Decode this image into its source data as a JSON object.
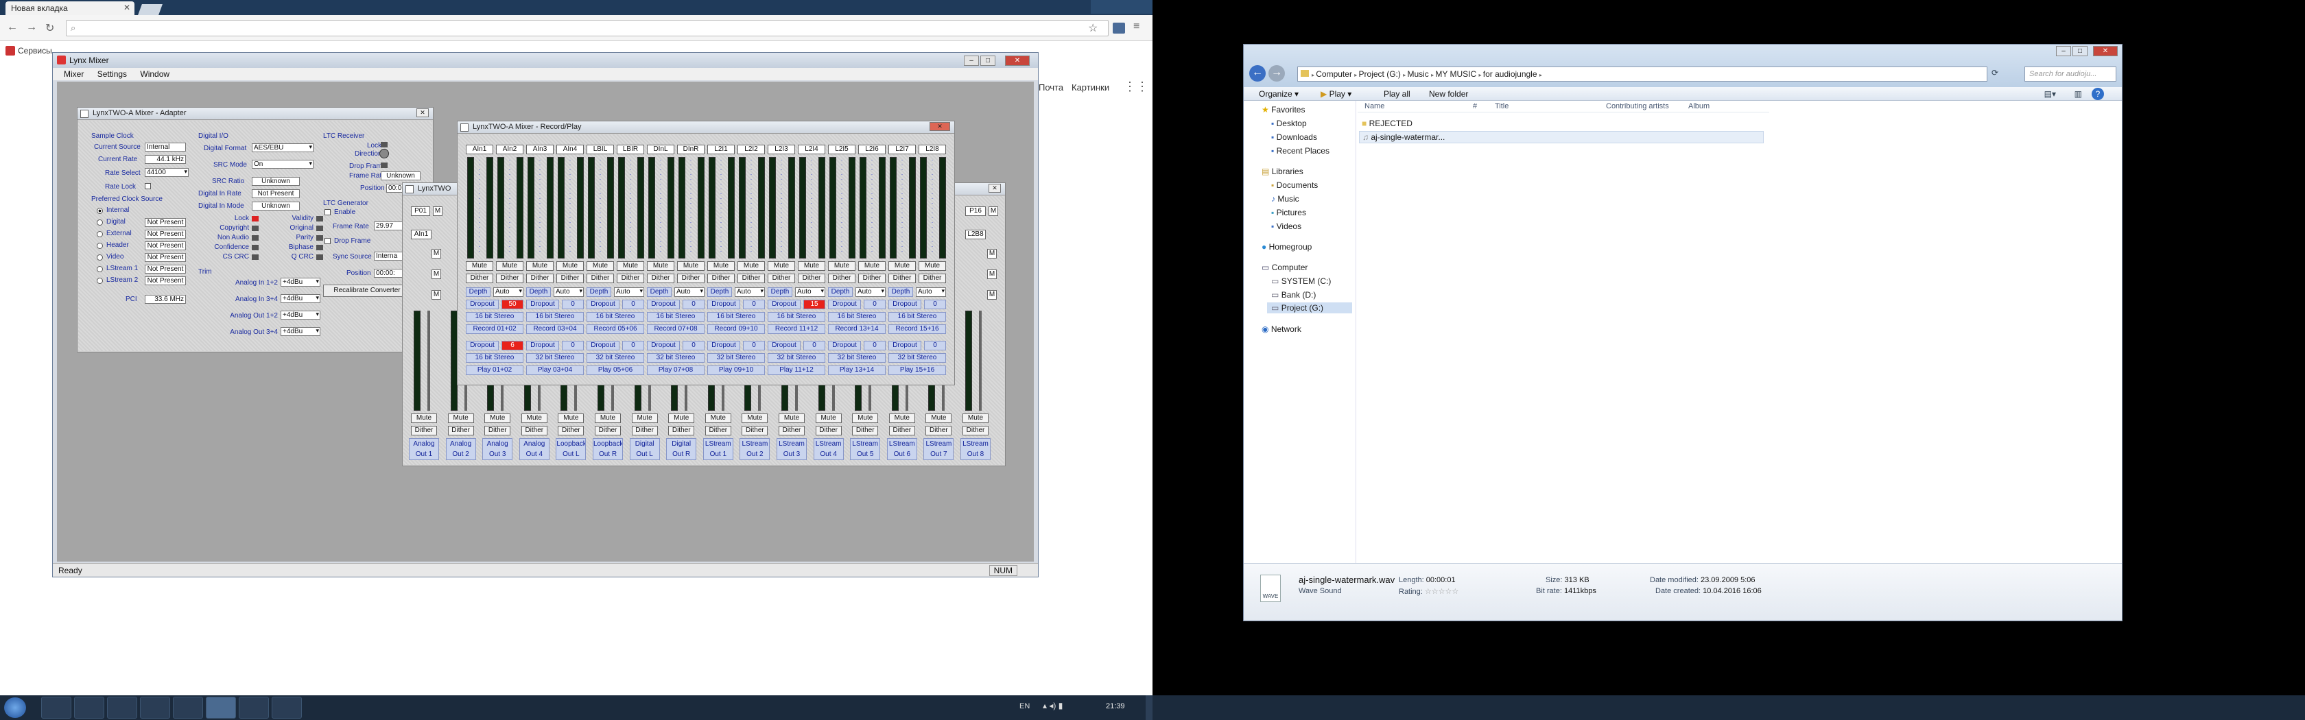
{
  "browser": {
    "tab_title": "Новая вкладка",
    "bookmark": "Сервисы",
    "top_links": [
      "Почта",
      "Картинки"
    ]
  },
  "mixer": {
    "title": "Lynx Mixer",
    "menu": [
      "Mixer",
      "Settings",
      "Window"
    ],
    "status": "Ready",
    "status_num": "NUM"
  },
  "adapter": {
    "title": "LynxTWO-A Mixer - Adapter",
    "sample_clock": "Sample Clock",
    "current_source_label": "Current Source",
    "current_source": "Internal",
    "current_rate_label": "Current Rate",
    "current_rate": "44.1 kHz",
    "rate_select_label": "Rate Select",
    "rate_select": "44100",
    "rate_lock_label": "Rate Lock",
    "preferred_clock": "Preferred Clock Source",
    "clock_sources": [
      {
        "name": "Internal",
        "status": ""
      },
      {
        "name": "Digital",
        "status": "Not Present"
      },
      {
        "name": "External",
        "status": "Not Present"
      },
      {
        "name": "Header",
        "status": "Not Present"
      },
      {
        "name": "Video",
        "status": "Not Present"
      },
      {
        "name": "LStream 1",
        "status": "Not Present"
      },
      {
        "name": "LStream 2",
        "status": "Not Present"
      }
    ],
    "pci_label": "PCI",
    "pci": "33.6 MHz",
    "digital_io": "Digital I/O",
    "digital_format_label": "Digital Format",
    "digital_format": "AES/EBU",
    "src_mode_label": "SRC Mode",
    "src_mode": "On",
    "src_ratio_label": "SRC Ratio",
    "src_ratio": "Unknown",
    "digital_in_rate_label": "Digital In Rate",
    "digital_in_rate": "Not Present",
    "digital_in_mode_label": "Digital In Mode",
    "digital_in_mode": "Unknown",
    "flags_left": [
      "Lock",
      "Copyright",
      "Non Audio",
      "Confidence",
      "CS CRC"
    ],
    "flags_right": [
      "Validity",
      "Original",
      "Parity",
      "Biphase",
      "Q CRC"
    ],
    "trim": "Trim",
    "trims": [
      {
        "label": "Analog In 1+2",
        "value": "+4dBu"
      },
      {
        "label": "Analog In 3+4",
        "value": "+4dBu"
      },
      {
        "label": "Analog Out 1+2",
        "value": "+4dBu"
      },
      {
        "label": "Analog Out 3+4",
        "value": "+4dBu"
      }
    ],
    "ltc_receiver": "LTC Receiver",
    "ltc_lock": "Lock",
    "ltc_direction": "Direction",
    "ltc_drop_frame": "Drop Frame",
    "ltc_frame_rate_label": "Frame Rate",
    "ltc_frame_rate": "Unknown",
    "ltc_position_label": "Position",
    "ltc_position": "00:00:",
    "ltc_generator": "LTC Generator",
    "gen_enable": "Enable",
    "gen_drop_frame": "Drop Frame",
    "gen_frame_rate_label": "Frame Rate",
    "gen_frame_rate": "29.97",
    "gen_sync_label": "Sync Source",
    "gen_sync": "Interna",
    "gen_position_label": "Position",
    "gen_position": "00:00:",
    "recalibrate": "Recalibrate Converter"
  },
  "play_window": {
    "title": "LynxTWO",
    "left_heads": [
      "P01",
      "AIn1"
    ],
    "right_heads": [
      "P16",
      "L2B8"
    ],
    "mute": "Mute",
    "dither": "Dither",
    "outputs": [
      [
        "Analog",
        "Out 1"
      ],
      [
        "Analog",
        "Out 2"
      ],
      [
        "Analog",
        "Out 3"
      ],
      [
        "Analog",
        "Out 4"
      ],
      [
        "Loopback",
        "Out L"
      ],
      [
        "Loopback",
        "Out R"
      ],
      [
        "Digital",
        "Out L"
      ],
      [
        "Digital",
        "Out R"
      ],
      [
        "LStream",
        "Out 1"
      ],
      [
        "LStream",
        "Out 2"
      ],
      [
        "LStream",
        "Out 3"
      ],
      [
        "LStream",
        "Out 4"
      ],
      [
        "LStream",
        "Out 5"
      ],
      [
        "LStream",
        "Out 6"
      ],
      [
        "LStream",
        "Out 7"
      ],
      [
        "LStream",
        "Out 8"
      ]
    ]
  },
  "record_play": {
    "title": "LynxTWO-A Mixer - Record/Play",
    "heads": [
      "AIn1",
      "AIn2",
      "AIn3",
      "AIn4",
      "LBIL",
      "LBIR",
      "DInL",
      "DInR",
      "L2I1",
      "L2I2",
      "L2I3",
      "L2I4",
      "L2I5",
      "L2I6",
      "L2I7",
      "L2I8"
    ],
    "mute": "Mute",
    "dither": "Dither",
    "depth": "Depth",
    "auto": "Auto",
    "dropout": "Dropout",
    "rec_dropouts": [
      "50",
      "0",
      "0",
      "0",
      "0",
      "15",
      "0",
      "0"
    ],
    "rec_formats": [
      "16 bit Stereo",
      "16 bit Stereo",
      "16 bit Stereo",
      "16 bit Stereo",
      "16 bit Stereo",
      "16 bit Stereo",
      "16 bit Stereo",
      "16 bit Stereo"
    ],
    "records": [
      "Record 01+02",
      "Record 03+04",
      "Record 05+06",
      "Record 07+08",
      "Record 09+10",
      "Record 11+12",
      "Record 13+14",
      "Record 15+16"
    ],
    "play_dropouts": [
      "6",
      "0",
      "0",
      "0",
      "0",
      "0",
      "0",
      "0"
    ],
    "play_formats": [
      "16 bit Stereo",
      "32 bit Stereo",
      "32 bit Stereo",
      "32 bit Stereo",
      "32 bit Stereo",
      "32 bit Stereo",
      "32 bit Stereo",
      "32 bit Stereo"
    ],
    "plays": [
      "Play 01+02",
      "Play 03+04",
      "Play 05+06",
      "Play 07+08",
      "Play 09+10",
      "Play 11+12",
      "Play 13+14",
      "Play 15+16"
    ]
  },
  "explorer": {
    "breadcrumb": [
      "Computer",
      "Project (G:)",
      "Music",
      "MY MUSIC",
      "for audiojungle"
    ],
    "search_placeholder": "Search for audioju...",
    "toolbar": [
      "Organize",
      "Play",
      "Play all",
      "New folder"
    ],
    "favorites": "Favorites",
    "fav_items": [
      "Desktop",
      "Downloads",
      "Recent Places"
    ],
    "libraries": "Libraries",
    "lib_items": [
      "Documents",
      "Music",
      "Pictures",
      "Videos"
    ],
    "homegroup": "Homegroup",
    "computer": "Computer",
    "drives": [
      "SYSTEM (C:)",
      "Bank (D:)",
      "Project (G:)"
    ],
    "network": "Network",
    "columns": [
      "Name",
      "#",
      "Title",
      "Contributing artists",
      "Album"
    ],
    "files": [
      "REJECTED",
      "aj-single-watermar..."
    ],
    "details": {
      "filename": "aj-single-watermark.wav",
      "type": "Wave Sound",
      "length_label": "Length:",
      "length": "00:00:01",
      "rating_label": "Rating:",
      "rating_stars": "☆☆☆☆☆",
      "size_label": "Size:",
      "size": "313 KB",
      "bitrate_label": "Bit rate:",
      "bitrate": "1411kbps",
      "modified_label": "Date modified:",
      "modified": "23.09.2009 5:06",
      "created_label": "Date created:",
      "created": "10.04.2016 16:06"
    }
  },
  "taskbar": {
    "lang": "EN",
    "clock": "21:39"
  }
}
